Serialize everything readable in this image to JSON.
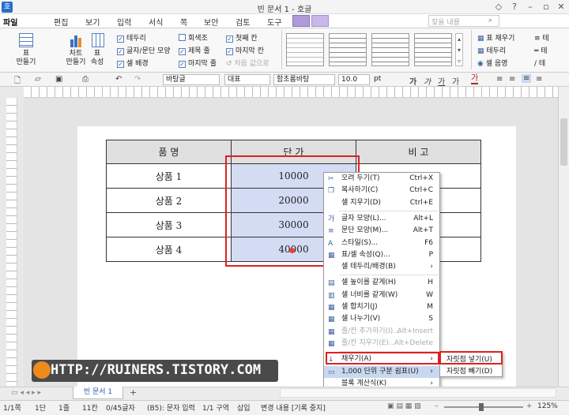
{
  "window": {
    "title": "빈 문서 1 - 호글",
    "logo": "호",
    "min": "–",
    "restore": "▫",
    "close": "✕",
    "extra": "◇",
    "help": "?"
  },
  "menubar": {
    "items": [
      "파일",
      "편집",
      "보기",
      "입력",
      "서식",
      "쪽",
      "보안",
      "검토",
      "도구"
    ],
    "search_placeholder": "찾을 내용"
  },
  "ribbon": {
    "table_btn": "표\n만들기",
    "chart_btn": "차트\n만들기",
    "tableprop_btn": "표\n속성",
    "checks_col1": [
      {
        "label": "테두리",
        "checked": true
      },
      {
        "label": "글자/문단 모양",
        "checked": true
      },
      {
        "label": "셀 배경",
        "checked": true
      }
    ],
    "checks_col2": [
      {
        "label": "회색조",
        "checked": false
      },
      {
        "label": "제목 줄",
        "checked": true
      },
      {
        "label": "마지막 줄",
        "checked": true
      }
    ],
    "checks_col3": [
      {
        "label": "첫째 칸",
        "checked": true
      },
      {
        "label": "마지막 칸",
        "checked": true
      },
      {
        "label": "처음 값으로",
        "checked": false,
        "dim": true
      }
    ],
    "right_items": [
      "표 채우기",
      "테두리",
      "셀 음영"
    ],
    "right_items2": [
      "테",
      "테",
      "테"
    ]
  },
  "format": {
    "style": "바탕글",
    "lang": "대표",
    "font": "함초롬바탕",
    "size": "10.0",
    "unit": "pt",
    "glyphs": [
      "가",
      "가",
      "가",
      "가",
      "가"
    ]
  },
  "table": {
    "headers": [
      "품 명",
      "단 가",
      "비 고"
    ],
    "rows": [
      [
        "상품 1",
        "10000",
        ""
      ],
      [
        "상품 2",
        "20000",
        ""
      ],
      [
        "상품 3",
        "30000",
        ""
      ],
      [
        "상품 4",
        "40000",
        ""
      ]
    ]
  },
  "context_menu": [
    {
      "label": "오려 두기(T)",
      "shortcut": "Ctrl+X",
      "icon": "scissors-icon",
      "glyph": "✂"
    },
    {
      "label": "복사하기(C)",
      "shortcut": "Ctrl+C",
      "icon": "copy-icon",
      "glyph": "❐"
    },
    {
      "label": "셀 지우기(D)",
      "shortcut": "Ctrl+E",
      "icon": "",
      "glyph": ""
    },
    {
      "sep": true
    },
    {
      "label": "글자 모양(L)...",
      "shortcut": "Alt+L",
      "icon": "char-shape-icon",
      "glyph": "가"
    },
    {
      "label": "문단 모양(M)...",
      "shortcut": "Alt+T",
      "icon": "para-shape-icon",
      "glyph": "≡"
    },
    {
      "label": "스타일(S)...",
      "shortcut": "F6",
      "icon": "style-icon",
      "glyph": "A"
    },
    {
      "label": "표/셀 속성(Q)...",
      "shortcut": "P",
      "icon": "table-prop-icon",
      "glyph": "▦"
    },
    {
      "label": "셀 테두리/배경(B)",
      "shortcut": "›",
      "icon": "",
      "glyph": ""
    },
    {
      "sep": true
    },
    {
      "label": "셀 높이를 같게(H)",
      "shortcut": "H",
      "icon": "row-height-icon",
      "glyph": "▤"
    },
    {
      "label": "셀 너비를 같게(W)",
      "shortcut": "W",
      "icon": "col-width-icon",
      "glyph": "▥"
    },
    {
      "label": "셀 합치기(J)",
      "shortcut": "M",
      "icon": "merge-icon",
      "glyph": "▦"
    },
    {
      "label": "셀 나누기(V)",
      "shortcut": "S",
      "icon": "split-icon",
      "glyph": "▦"
    },
    {
      "label": "줄/칸 추가하기(I)...",
      "shortcut": "Alt+Insert",
      "icon": "",
      "glyph": "▦",
      "dim": true
    },
    {
      "label": "줄/칸 지우기(E)...",
      "shortcut": "Alt+Delete",
      "icon": "",
      "glyph": "▦",
      "dim": true
    },
    {
      "sep": true
    },
    {
      "label": "채우기(A)",
      "shortcut": "›",
      "icon": "fill-icon",
      "glyph": "↓"
    },
    {
      "label": "1,000 단위 구분 쉼표(U)",
      "shortcut": "›",
      "icon": "comma-icon",
      "glyph": "▭",
      "hl": true
    },
    {
      "label": "블록 계산식(K)",
      "shortcut": "›",
      "icon": "",
      "glyph": ""
    },
    {
      "label": "차트(H)",
      "shortcut": "›",
      "icon": "chart-icon",
      "glyph": "▮"
    }
  ],
  "submenu": [
    "자릿점 넣기(U)",
    "자릿점 빼기(D)"
  ],
  "watermark": "HTTP://RUINERS.TISTORY.COM",
  "tabs": {
    "doc": "빈 문서 1",
    "add": "+"
  },
  "status": [
    "1/1쪽",
    "1단",
    "1줄",
    "11칸",
    "0/45글자",
    "(B5): 문자 입력",
    "1/1 구역",
    "삽입",
    "변경 내용 [기록 중지]",
    "125%"
  ]
}
